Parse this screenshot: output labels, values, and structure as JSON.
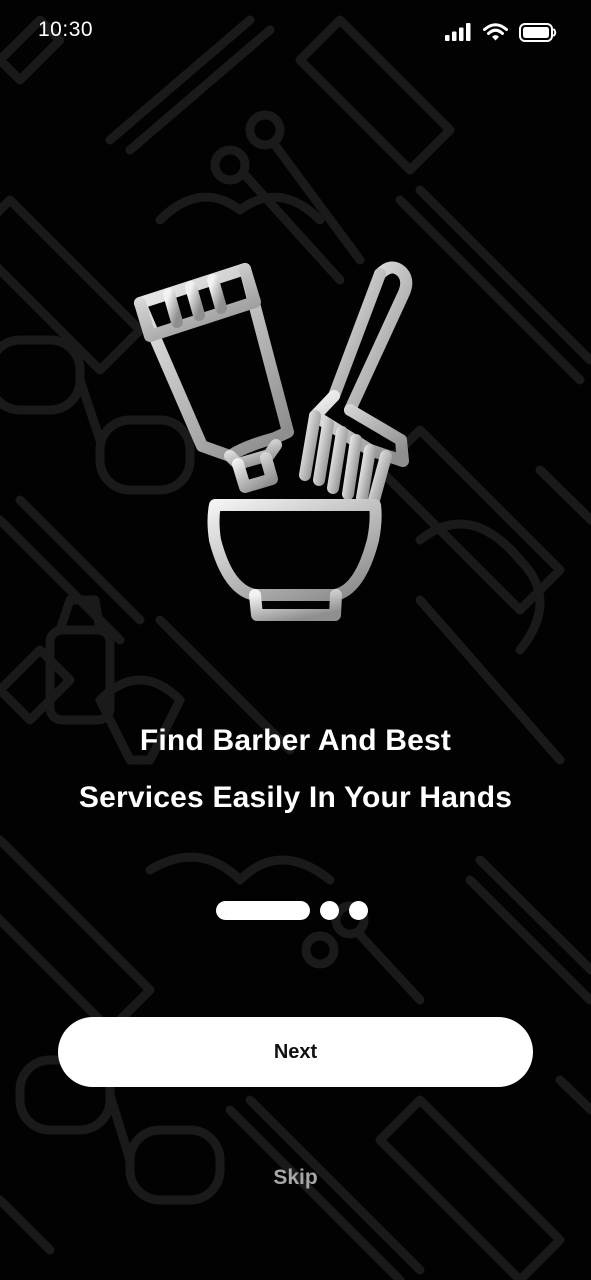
{
  "status_bar": {
    "time": "10:30",
    "icons": [
      "cellular-signal-icon",
      "wifi-icon",
      "battery-icon"
    ]
  },
  "background": {
    "pattern": "barber-tools-pattern",
    "color": "#020202",
    "pattern_color": "#1a1a1a"
  },
  "hero": {
    "illustration": "hair-dye-tube-brush-bowl-icon",
    "gradient_light": "#f2f2f2",
    "gradient_dark": "#8f8f8f"
  },
  "onboarding": {
    "headline_line_1": "Find Barber And Best",
    "headline_line_2": "Services Easily In Your Hands",
    "page_count": 3,
    "active_page": 1
  },
  "actions": {
    "next_label": "Next",
    "skip_label": "Skip"
  },
  "colors": {
    "button_background": "#ffffff",
    "button_text": "#111111",
    "skip_text": "#a7a7a7",
    "text_primary": "#ffffff"
  }
}
